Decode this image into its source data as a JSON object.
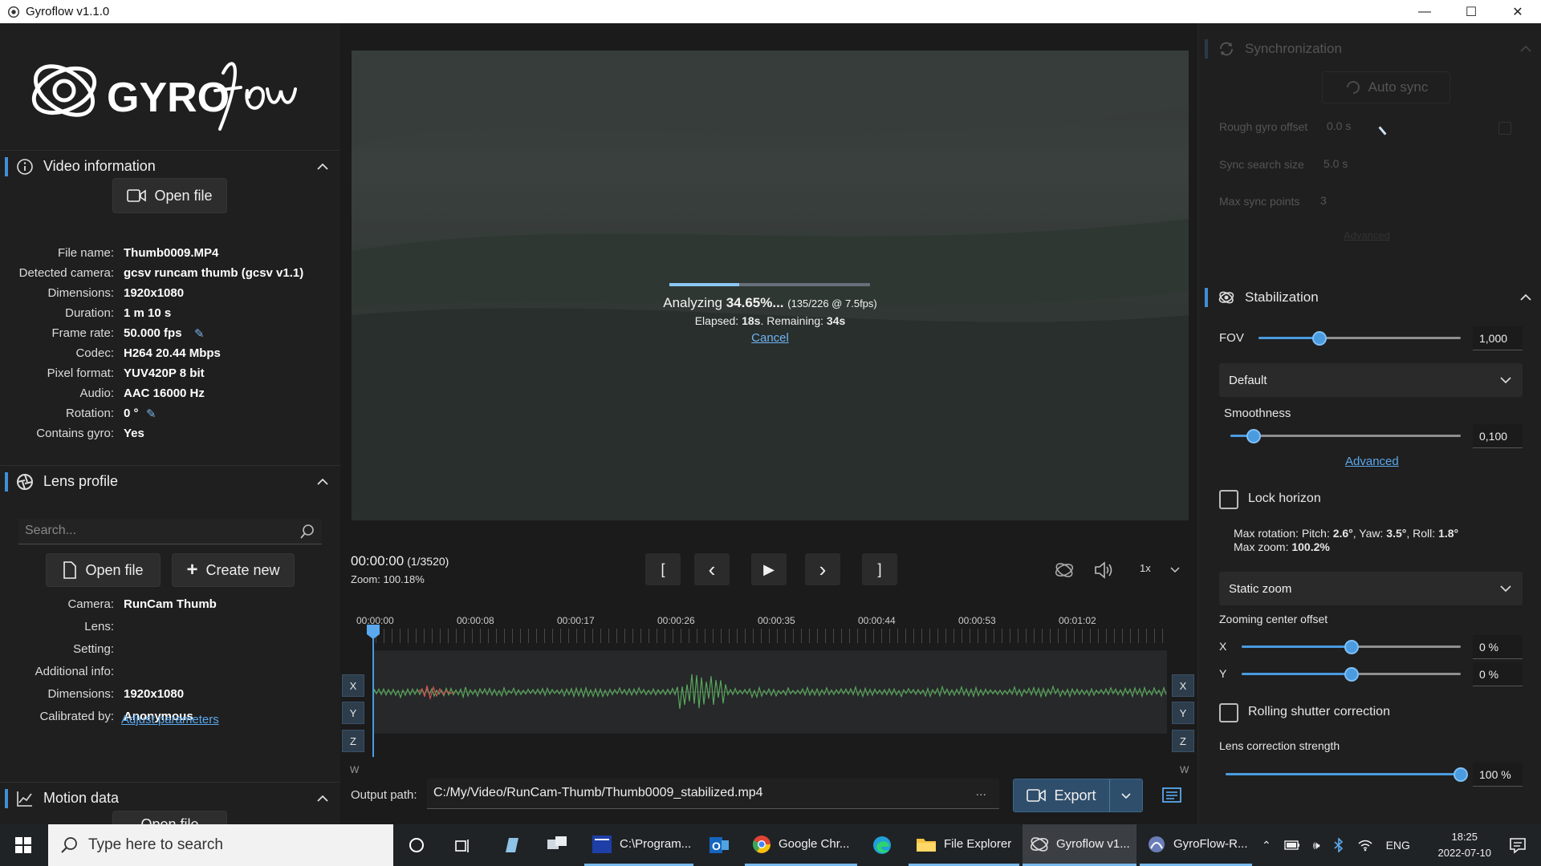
{
  "window": {
    "title": "Gyroflow v1.1.0",
    "minimize": "—",
    "maximize": "☐",
    "close": "✕"
  },
  "logo_text": "GYROflow",
  "video_info": {
    "title": "Video information",
    "open_file": "Open file",
    "rows": [
      {
        "label": "File name:",
        "value": "Thumb0009.MP4"
      },
      {
        "label": "Detected camera:",
        "value": "gcsv runcam thumb (gcsv v1.1)"
      },
      {
        "label": "Dimensions:",
        "value": "1920x1080"
      },
      {
        "label": "Duration:",
        "value": "1 m 10 s"
      },
      {
        "label": "Frame rate:",
        "value": "50.000 fps"
      },
      {
        "label": "Codec:",
        "value": "H264 20.44 Mbps"
      },
      {
        "label": "Pixel format:",
        "value": "YUV420P 8 bit"
      },
      {
        "label": "Audio:",
        "value": "AAC 16000 Hz"
      },
      {
        "label": "Rotation:",
        "value": "0 °"
      },
      {
        "label": "Contains gyro:",
        "value": "Yes"
      }
    ]
  },
  "lens_profile": {
    "title": "Lens profile",
    "search_placeholder": "Search...",
    "open_file": "Open file",
    "create_new": "Create new",
    "rows": [
      {
        "label": "Camera:",
        "value": "RunCam Thumb"
      },
      {
        "label": "Lens:",
        "value": ""
      },
      {
        "label": "Setting:",
        "value": ""
      },
      {
        "label": "Additional info:",
        "value": ""
      },
      {
        "label": "Dimensions:",
        "value": "1920x1080"
      },
      {
        "label": "Calibrated by:",
        "value": "Anonymous"
      }
    ],
    "adjust_link": "Adjust parameters"
  },
  "motion_data": {
    "title": "Motion data",
    "open_file": "Open file"
  },
  "analysis": {
    "progress": 0.3465,
    "label_prefix": "Analyzing ",
    "percent": "34.65%...",
    "detail": "(135/226 @ 7.5fps)",
    "elapsed_label": "Elapsed: ",
    "elapsed": "18s",
    "remaining_label": ". Remaining: ",
    "remaining": "34s",
    "cancel": "Cancel"
  },
  "playback": {
    "timecode": "00:00:00",
    "frames": "(1/3520)",
    "zoom": "Zoom: 100.18%",
    "btn_in": "[",
    "btn_prev": "‹",
    "btn_play": "▶",
    "btn_next": "›",
    "btn_out": "]",
    "speed": "1x"
  },
  "timeline": {
    "labels": [
      "00:00:00",
      "00:00:08",
      "00:00:17",
      "00:00:26",
      "00:00:35",
      "00:00:44",
      "00:00:53",
      "00:01:02"
    ],
    "axes": [
      "X",
      "Y",
      "Z"
    ],
    "w_label": "W"
  },
  "output": {
    "label": "Output path:",
    "path": "C:/My/Video/RunCam-Thumb/Thumb0009_stabilized.mp4",
    "browse": "...",
    "export": "Export"
  },
  "sync": {
    "title": "Synchronization",
    "auto_sync": "Auto sync",
    "rough_offset_label": "Rough gyro offset",
    "rough_offset_value": "0.0 s",
    "search_size_label": "Sync search size",
    "search_size_value": "5.0 s",
    "max_points_label": "Max sync points",
    "max_points_value": "3",
    "advanced": "Advanced"
  },
  "stabilization": {
    "title": "Stabilization",
    "fov_label": "FOV",
    "fov_value": "1,000",
    "fov_level": 0.3,
    "method": "Default",
    "smoothness_label": "Smoothness",
    "smoothness_value": "0,100",
    "smoothness_level": 0.1,
    "advanced": "Advanced",
    "lock_horizon": "Lock horizon",
    "max_rotation_prefix": "Max rotation: Pitch: ",
    "pitch": "2.6°",
    "yaw_label": ", Yaw: ",
    "yaw": "3.5°",
    "roll_label": ", Roll: ",
    "roll": "1.8°",
    "max_zoom_label": "Max zoom: ",
    "max_zoom": "100.2%",
    "zoom_mode": "Static zoom",
    "zoom_center_label": "Zooming center offset",
    "x_label": "X",
    "x_value": "0 %",
    "y_label": "Y",
    "y_value": "0 %",
    "center_level": 0.5,
    "rolling_shutter": "Rolling shutter correction",
    "lens_strength_label": "Lens correction strength",
    "lens_strength_value": "100 %",
    "lens_strength_level": 1.0
  },
  "taskbar": {
    "search_placeholder": "Type here to search",
    "apps": [
      {
        "label": "C:\\Program..."
      },
      {
        "label": "Google Chr..."
      },
      {
        "label": "File Explorer"
      },
      {
        "label": "Gyroflow v1..."
      },
      {
        "label": "GyroFlow-R..."
      }
    ],
    "lang": "ENG",
    "time": "18:25",
    "date": "2022-07-10"
  },
  "colors": {
    "accent": "#4a9be0",
    "background": "#1f1f1f"
  }
}
